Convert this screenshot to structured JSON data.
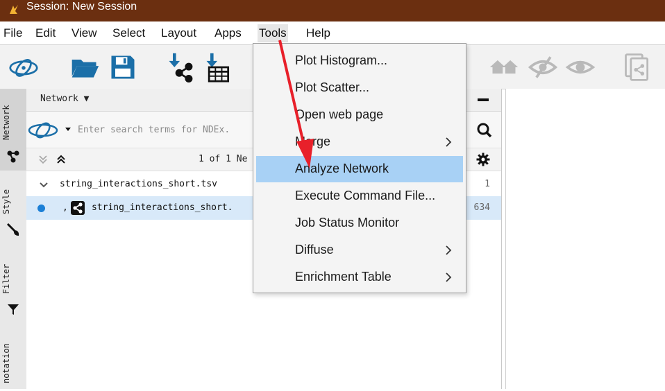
{
  "window": {
    "title": "Session: New Session"
  },
  "menubar": {
    "items": [
      {
        "label": "File"
      },
      {
        "label": "Edit"
      },
      {
        "label": "View"
      },
      {
        "label": "Select"
      },
      {
        "label": "Layout"
      },
      {
        "label": "Apps"
      },
      {
        "label": "Tools"
      },
      {
        "label": "Help"
      }
    ],
    "active": "Tools"
  },
  "side_tabs": [
    {
      "label": "Network",
      "icon": "network-icon"
    },
    {
      "label": "Style",
      "icon": "brush-icon"
    },
    {
      "label": "Filter",
      "icon": "filter-icon"
    },
    {
      "label": "notation"
    }
  ],
  "network_panel": {
    "title": "Network ▼",
    "search": {
      "placeholder": "Enter search terms for NDEx."
    },
    "count_text": "1 of 1 Ne",
    "rows": [
      {
        "name": "string_interactions_short.tsv",
        "count": "1"
      },
      {
        "prefix": ",",
        "name": "string_interactions_short.",
        "count": "634"
      }
    ]
  },
  "tools_menu": {
    "items": [
      {
        "label": "Plot Histogram...",
        "submenu": false
      },
      {
        "label": "Plot Scatter...",
        "submenu": false
      },
      {
        "label": "Open web page",
        "submenu": false
      },
      {
        "label": "Merge",
        "submenu": true
      },
      {
        "label": "Analyze Network",
        "submenu": false,
        "highlighted": true
      },
      {
        "label": "Execute Command File...",
        "submenu": false
      },
      {
        "label": "Job Status Monitor",
        "submenu": false
      },
      {
        "label": "Diffuse",
        "submenu": true
      },
      {
        "label": "Enrichment Table",
        "submenu": true
      }
    ]
  },
  "colors": {
    "titlebar": "#6b2f10",
    "highlight": "#a8d1f5",
    "icon_blue": "#1b6fa8",
    "annotation_arrow": "#e8202a"
  }
}
